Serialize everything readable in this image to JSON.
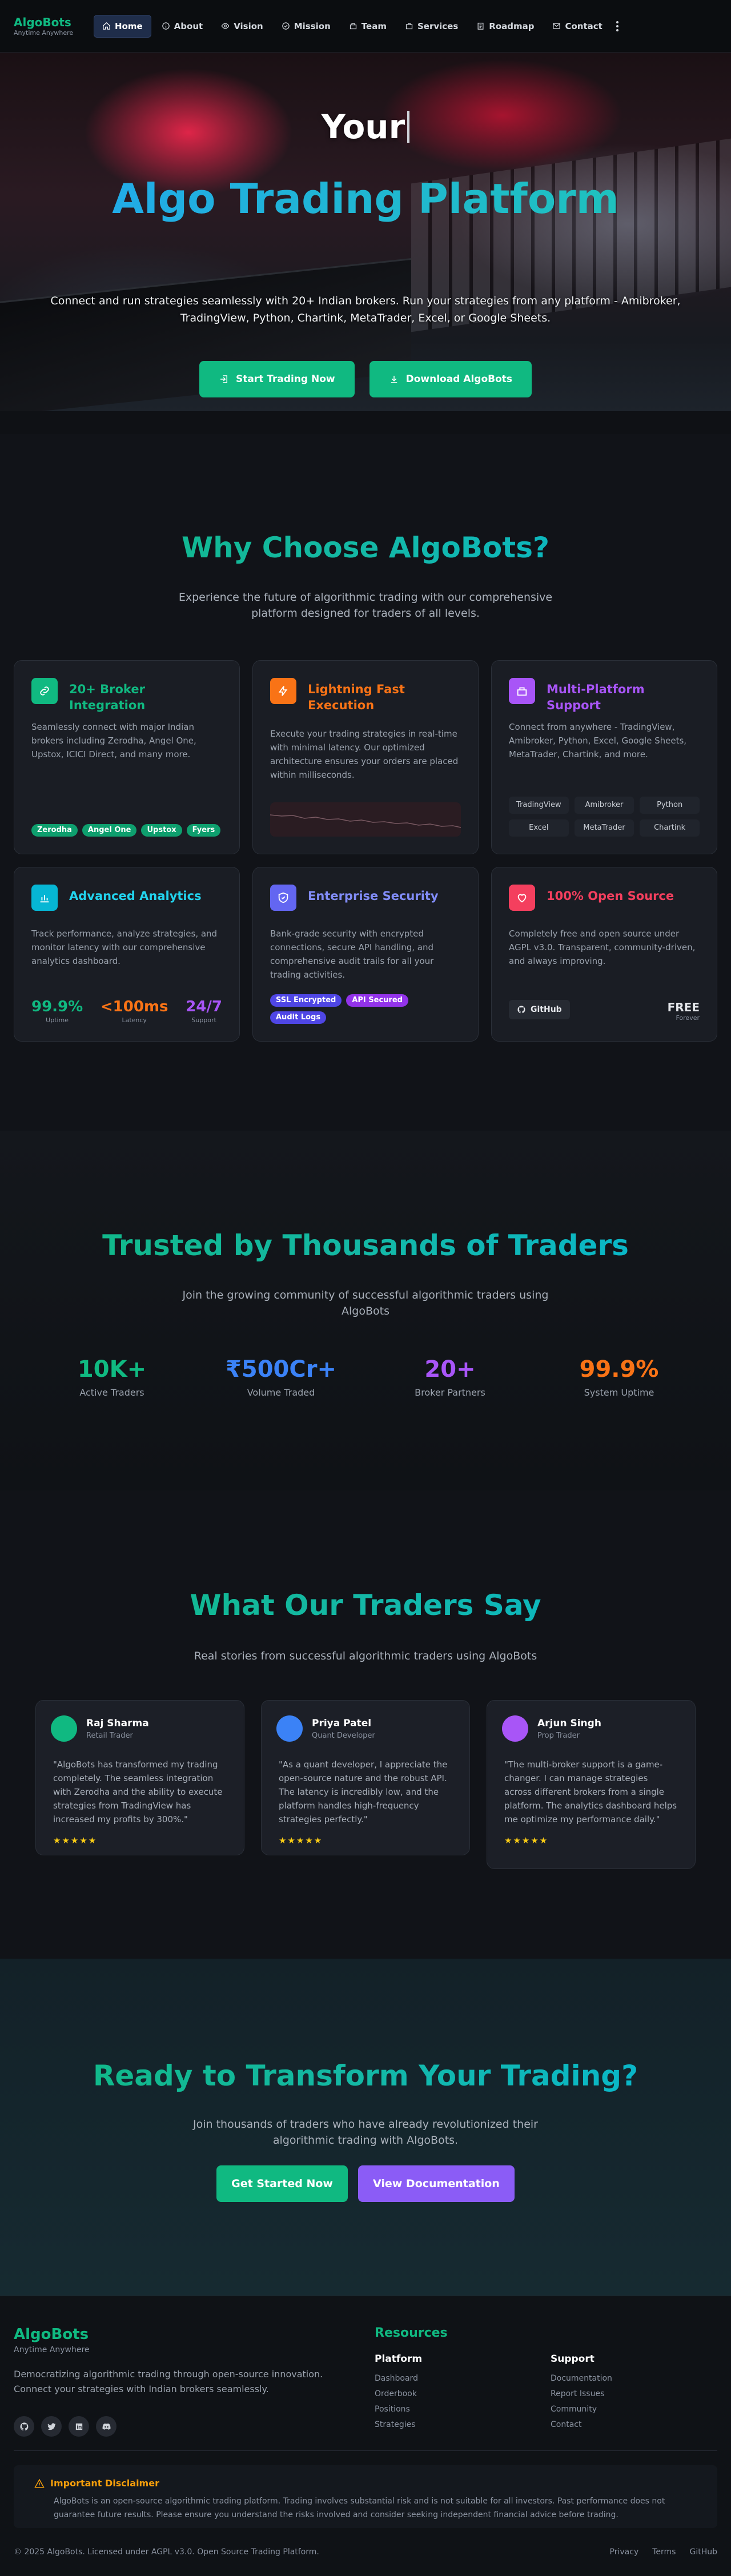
{
  "nav": {
    "brand": "AlgoBots",
    "tagline": "Anytime Anywhere",
    "items": [
      "Home",
      "About",
      "Vision",
      "Mission",
      "Team",
      "Services",
      "Roadmap",
      "Contact"
    ]
  },
  "hero": {
    "typed": "Your",
    "title": "Algo Trading Platform",
    "subtitle": "Connect and run strategies seamlessly with 20+ Indian brokers. Run your strategies from any platform - Amibroker, TradingView, Python, Chartink, MetaTrader, Excel, or Google Sheets.",
    "cta_primary": "Start Trading Now",
    "cta_secondary": "Download AlgoBots"
  },
  "why": {
    "title": "Why Choose AlgoBots?",
    "subtitle": "Experience the future of algorithmic trading with our comprehensive platform designed for traders of all levels.",
    "cards": [
      {
        "title": "20+ Broker Integration",
        "desc": "Seamlessly connect with major Indian brokers including Zerodha, Angel One, Upstox, ICICI Direct, and many more.",
        "chips": [
          "Zerodha",
          "Angel One",
          "Upstox",
          "Fyers"
        ]
      },
      {
        "title": "Lightning Fast Execution",
        "desc": "Execute your trading strategies in real-time with minimal latency. Our optimized architecture ensures your orders are placed within milliseconds."
      },
      {
        "title": "Multi-Platform Support",
        "desc": "Connect from anywhere - TradingView, Amibroker, Python, Excel, Google Sheets, MetaTrader, Chartink, and more.",
        "platforms": [
          "TradingView",
          "Amibroker",
          "Python",
          "Excel",
          "MetaTrader",
          "Chartink"
        ]
      },
      {
        "title": "Advanced Analytics",
        "desc": "Track performance, analyze strategies, and monitor latency with our comprehensive analytics dashboard.",
        "stats": [
          {
            "value": "99.9%",
            "label": "Uptime"
          },
          {
            "value": "<100ms",
            "label": "Latency"
          },
          {
            "value": "24/7",
            "label": "Support"
          }
        ]
      },
      {
        "title": "Enterprise Security",
        "desc": "Bank-grade security with encrypted connections, secure API handling, and comprehensive audit trails for all your trading activities.",
        "chips": [
          "SSL Encrypted",
          "API Secured",
          "Audit Logs"
        ]
      },
      {
        "title": "100% Open Source",
        "desc": "Completely free and open source under AGPL v3.0. Transparent, community-driven, and always improving.",
        "github": "GitHub",
        "free_value": "FREE",
        "free_label": "Forever"
      }
    ]
  },
  "trust": {
    "title": "Trusted by Thousands of Traders",
    "subtitle": "Join the growing community of successful algorithmic traders using AlgoBots",
    "stats": [
      {
        "value": "10K+",
        "label": "Active Traders"
      },
      {
        "value": "₹500Cr+",
        "label": "Volume Traded"
      },
      {
        "value": "20+",
        "label": "Broker Partners"
      },
      {
        "value": "99.9%",
        "label": "System Uptime"
      }
    ]
  },
  "testimonials": {
    "title": "What Our Traders Say",
    "subtitle": "Real stories from successful algorithmic traders using AlgoBots",
    "items": [
      {
        "name": "Raj Sharma",
        "role": "Retail Trader",
        "quote": "\"AlgoBots has transformed my trading completely. The seamless integration with Zerodha and the ability to execute strategies from TradingView has increased my profits by 300%.\"",
        "stars": "★★★★★"
      },
      {
        "name": "Priya Patel",
        "role": "Quant Developer",
        "quote": "\"As a quant developer, I appreciate the open-source nature and the robust API. The latency is incredibly low, and the platform handles high-frequency strategies perfectly.\"",
        "stars": "★★★★★"
      },
      {
        "name": "Arjun Singh",
        "role": "Prop Trader",
        "quote": "\"The multi-broker support is a game-changer. I can manage strategies across different brokers from a single platform. The analytics dashboard helps me optimize my performance daily.\"",
        "stars": "★★★★★"
      }
    ]
  },
  "ready": {
    "title": "Ready to Transform Your Trading?",
    "subtitle": "Join thousands of traders who have already revolutionized their algorithmic trading with AlgoBots.",
    "cta_primary": "Get Started Now",
    "cta_secondary": "View Documentation"
  },
  "footer": {
    "brand": "AlgoBots",
    "tagline": "Anytime Anywhere",
    "desc": "Democratizing algorithmic trading through open-source innovation. Connect your strategies with Indian brokers seamlessly.",
    "resources": "Resources",
    "platform_heading": "Platform",
    "platform_items": [
      "Dashboard",
      "Orderbook",
      "Positions",
      "Strategies"
    ],
    "support_heading": "Support",
    "support_items": [
      "Documentation",
      "Report Issues",
      "Community",
      "Contact"
    ],
    "disclaimer_title": "Important Disclaimer",
    "disclaimer_text": "AlgoBots is an open-source algorithmic trading platform. Trading involves substantial risk and is not suitable for all investors. Past performance does not guarantee future results. Please ensure you understand the risks involved and consider seeking independent financial advice before trading.",
    "copyright": "© 2025 AlgoBots. Licensed under AGPL v3.0. Open Source Trading Platform.",
    "links": [
      "Privacy",
      "Terms",
      "GitHub"
    ]
  },
  "colors": {
    "accent": "#10b981",
    "purple": "#8b5cf6",
    "orange": "#f97316",
    "blue": "#3b82f6",
    "red": "#f43f5e"
  }
}
